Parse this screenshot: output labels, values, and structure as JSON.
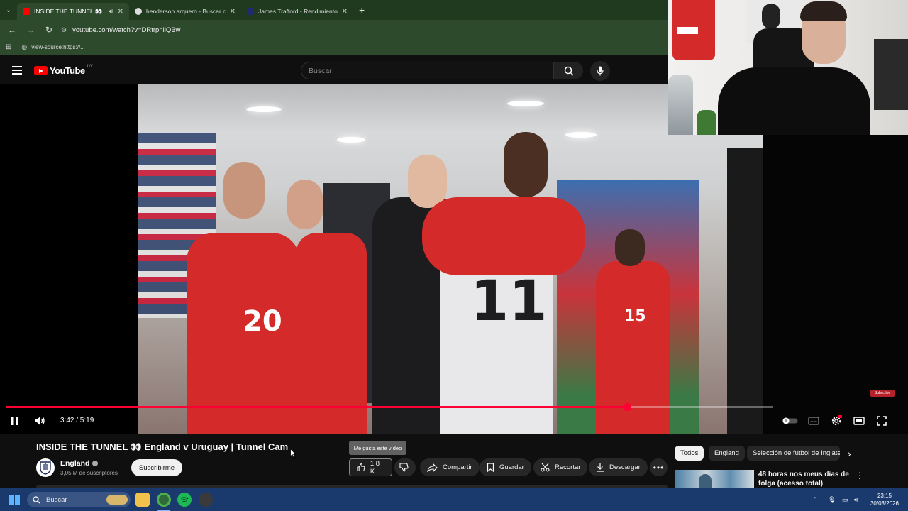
{
  "browser": {
    "tabs": [
      {
        "title": "INSIDE THE TUNNEL 👀 En",
        "fav_color": "#ff0000",
        "active": true
      },
      {
        "title": "henderson arquero - Buscar co",
        "fav_color": "#dddddd",
        "active": false
      },
      {
        "title": "James Trafford - Rendimiento p",
        "fav_color": "#1e2a6e",
        "active": false
      }
    ],
    "url": "youtube.com/watch?v=DRtrpniiQBw",
    "bookmark": "view-source:https://..."
  },
  "youtube": {
    "logo_text": "YouTube",
    "country_code": "UY",
    "search_placeholder": "Buscar"
  },
  "video": {
    "current_time": "3:42",
    "duration": "5:19",
    "time_display": "3:42 / 5:19",
    "progress_fraction": 0.81,
    "buffered_fraction": 1.0,
    "title": "INSIDE THE TUNNEL 👀 England v Uruguay | Tunnel Cam",
    "overlay_chip": "Subscribe"
  },
  "channel": {
    "name": "England",
    "subscribers": "3,05 M de suscriptores",
    "subscribe_label": "Suscribirme"
  },
  "actions": {
    "tooltip": "Me gusta este vídeo",
    "likes": "1,8 K",
    "share": "Compartir",
    "save": "Guardar",
    "clip": "Recortar",
    "download": "Descargar"
  },
  "related": {
    "chips": [
      "Todos",
      "England",
      "Selección de fútbol de Inglaterra"
    ],
    "first_video_title": "48 horas nos meus dias de folga (acesso total)"
  },
  "taskbar": {
    "search_label": "Buscar",
    "time": "23:15",
    "date": "30/03/2026"
  },
  "colors": {
    "accent": "#ff0033",
    "chrome_green": "#2d4a2d",
    "taskbar_blue": "#1a3a6e"
  }
}
